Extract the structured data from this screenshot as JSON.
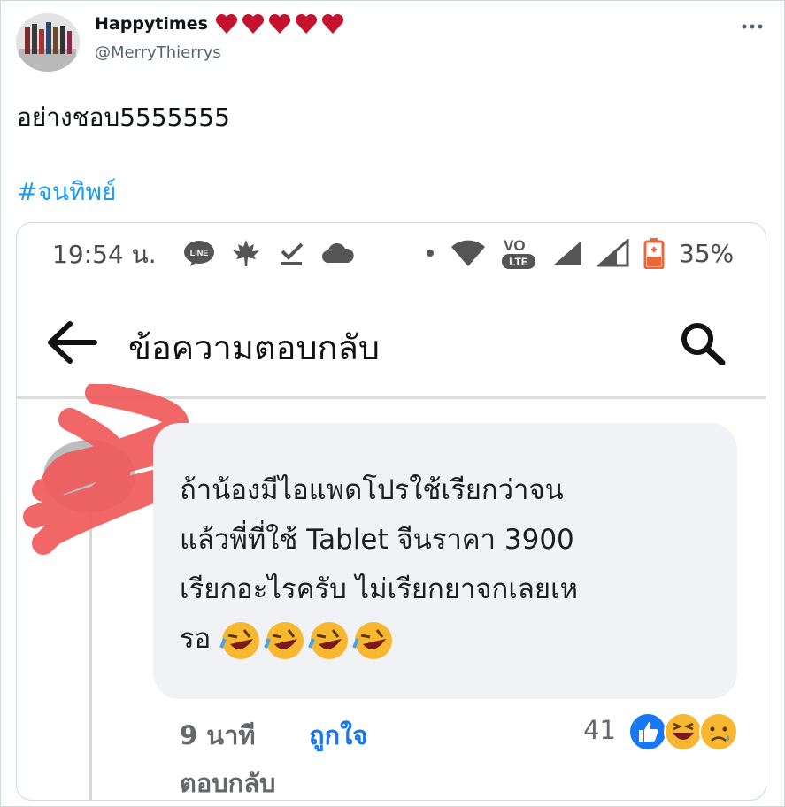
{
  "tweet": {
    "display_name": "Happytimes",
    "name_emoji": [
      "heart-icon",
      "heart-icon",
      "heart-icon",
      "heart-icon",
      "heart-icon"
    ],
    "handle": "@MerryThierrys",
    "text": "อย่างชอบ5555555",
    "hashtag": "#จนทิพย์",
    "more_icon": "more-icon",
    "colors": {
      "hashtag": "#1d9bf0",
      "heart": "#c4122f",
      "handle": "#536471"
    }
  },
  "screenshot": {
    "status_bar": {
      "time": "19:54 น.",
      "icons": [
        "line-icon",
        "maple-leaf-icon",
        "download-check-icon",
        "cloud-icon",
        "dot-icon",
        "wifi-icon",
        "volte-icon",
        "signal-icon",
        "signal-icon",
        "battery-icon"
      ],
      "battery": "35%"
    },
    "app_bar": {
      "title": "ข้อความตอบกลับ",
      "back_icon": "arrow-left-icon",
      "search_icon": "search-icon"
    },
    "comment": {
      "lines": [
        "ถ้าน้องมีไอแพดโปรใช้เรียกว่าจน",
        "แล้วพี่ที่ใช้ Tablet จีนราคา 3900",
        "เรียกอะไรครับ  ไม่เรียกยาจกเลยเห",
        "รอ"
      ],
      "emojis": [
        "rolling-laughing-emoji",
        "rolling-laughing-emoji",
        "rolling-laughing-emoji",
        "rolling-laughing-emoji"
      ],
      "time": "9 นาที",
      "like_label": "ถูกใจ",
      "reply_label": "ตอบกลับ",
      "reaction_count": "41",
      "reactions": [
        "like-reaction-icon",
        "haha-reaction-icon",
        "sad-reaction-icon"
      ],
      "colors": {
        "like": "#1877f2",
        "bubble": "#f0f2f5",
        "scribble": "#f05a5a"
      }
    }
  }
}
